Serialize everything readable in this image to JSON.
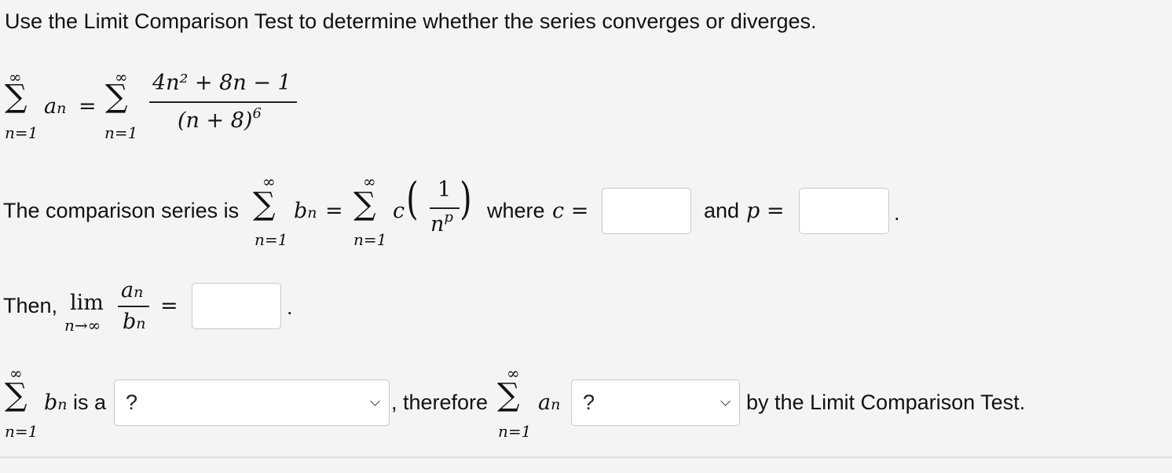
{
  "prompt": "Use the Limit Comparison Test to determine whether the series converges or diverges.",
  "series": {
    "sum_upper": "∞",
    "sum_lower": "n=1",
    "term_a": "a",
    "term_a_sub": "n",
    "numerator": "4n² + 8n − 1",
    "denominator_base": "(n + 8)",
    "denominator_exp": "6"
  },
  "comparison": {
    "label": "The comparison series is",
    "term_b": "b",
    "term_b_sub": "n",
    "c_symbol": "c",
    "frac_num": "1",
    "frac_den": "n",
    "frac_den_exp": "p",
    "where_label": "where",
    "c_label": "c =",
    "and_label": "and",
    "p_label": "p =",
    "c_value": "",
    "p_value": "",
    "period": "."
  },
  "limit": {
    "then_label": "Then,",
    "lim": "lim",
    "lim_sub": "n→∞",
    "num": "a",
    "num_sub": "n",
    "den": "b",
    "den_sub": "n",
    "eq": "=",
    "value": "",
    "period": "."
  },
  "conclusion": {
    "is_a_label": "is a",
    "select1_value": "?",
    "therefore_label": ", therefore",
    "select2_value": "?",
    "by_label": "by the Limit Comparison Test."
  },
  "symbols": {
    "sigma": "∑",
    "eq": "=",
    "lparen": "(",
    "rparen": ")"
  }
}
